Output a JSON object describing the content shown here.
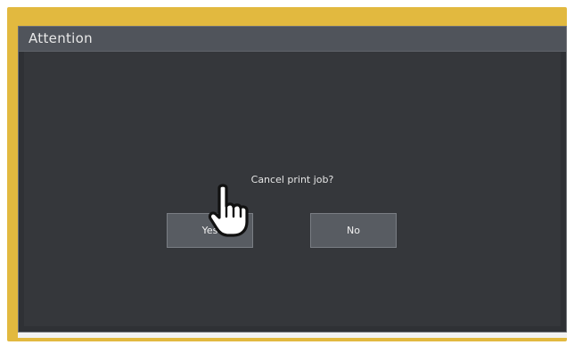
{
  "dialog": {
    "title": "Attention",
    "message": "Cancel print job?",
    "buttons": {
      "yes_label": "Yes",
      "no_label": "No"
    }
  },
  "colors": {
    "frame": "#e2b93f",
    "titlebar": "#50545b",
    "content_bg": "#35373b",
    "button_bg": "#585c62"
  },
  "icons": {
    "pointer": "hand-pointer-icon"
  }
}
